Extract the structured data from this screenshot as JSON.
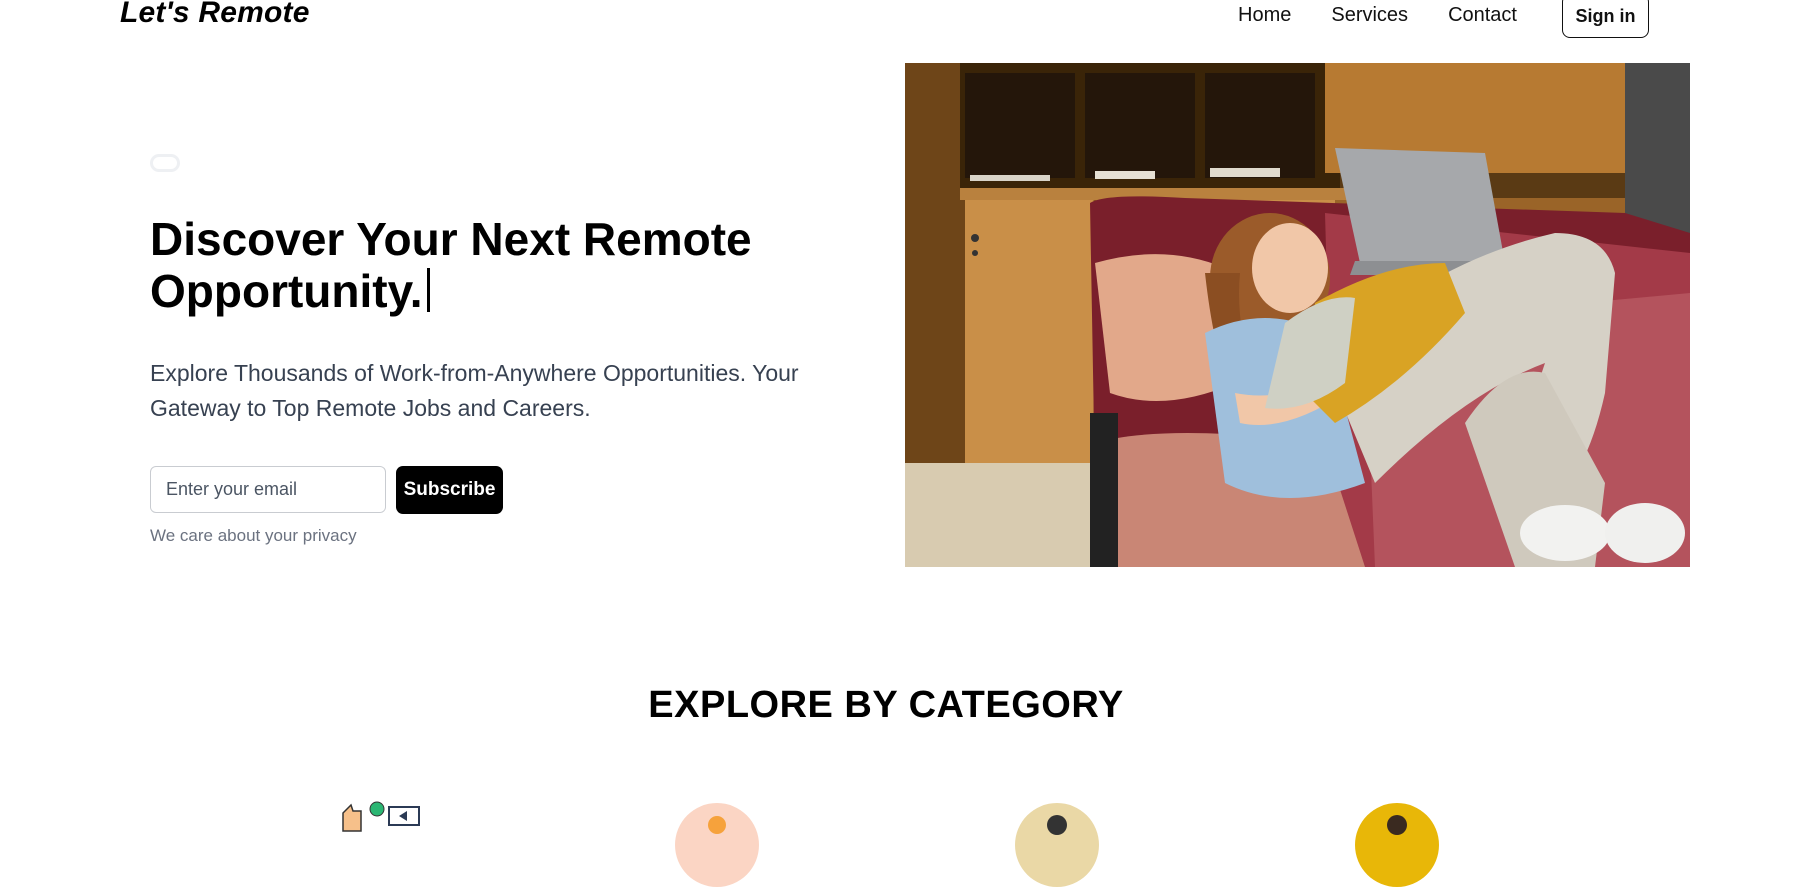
{
  "brand": {
    "logo": "Let's Remote"
  },
  "nav": {
    "links": [
      "Home",
      "Services",
      "Contact"
    ],
    "signin_label": "Sign in"
  },
  "hero": {
    "title": "Discover Your Next Remote Opportunity.",
    "subtitle": "Explore Thousands of Work-from-Anywhere Opportunities. Your Gateway to Top Remote Jobs and Careers.",
    "email_placeholder": "Enter your email",
    "subscribe_label": "Subscribe",
    "privacy_note": "We care about your privacy",
    "image_alt_icon": "woman-on-couch-with-laptop-photo"
  },
  "categories": {
    "title": "EXPLORE BY CATEGORY",
    "icons": [
      "marketing-icon",
      "design-icon",
      "support-icon",
      "developer-icon"
    ],
    "colors": [
      "#ffffff",
      "#fbd5c4",
      "#ead8a6",
      "#e8b708"
    ]
  },
  "colors": {
    "primary": "#000000",
    "text_muted": "#6b7280",
    "text_body": "#374151",
    "input_border": "#c9ccd1"
  }
}
